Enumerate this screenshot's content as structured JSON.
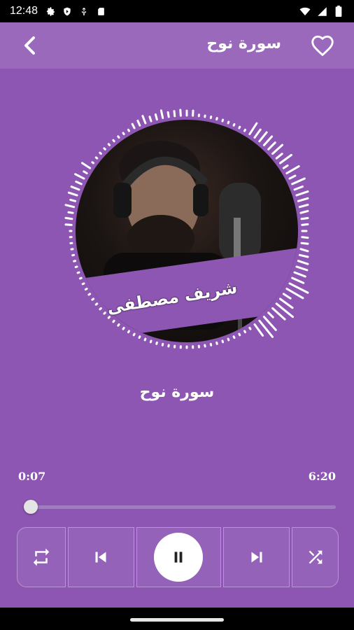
{
  "status_bar": {
    "time": "12:48",
    "left_icons": [
      "gear-icon",
      "shield-icon",
      "usb-icon",
      "sd-card-icon"
    ],
    "right_icons": [
      "wifi-icon",
      "signal-icon",
      "battery-icon"
    ]
  },
  "app_bar": {
    "title": "سورة نوح",
    "back_icon": "chevron-left-icon",
    "favorite_icon": "heart-outline-icon"
  },
  "album_art": {
    "caption": "شريف مصطفى"
  },
  "player": {
    "track_title": "سورة نوح",
    "current_time": "0:07",
    "total_time": "6:20",
    "progress_fraction": 0.018
  },
  "controls": {
    "repeat_icon": "repeat-icon",
    "previous_icon": "skip-previous-icon",
    "play_pause_icon": "pause-icon",
    "next_icon": "skip-next-icon",
    "shuffle_icon": "shuffle-icon"
  },
  "colors": {
    "background": "#8e56b3",
    "app_bar": "#9a69bc",
    "accent": "#ffffff"
  }
}
